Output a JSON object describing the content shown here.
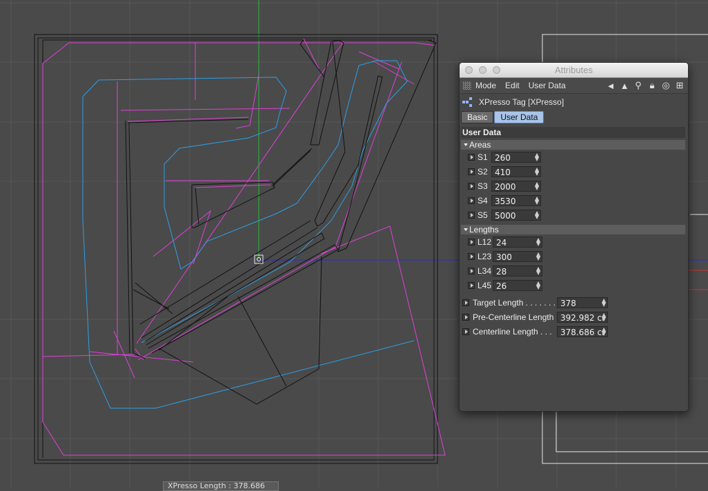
{
  "viewport": {
    "status_text": "XPresso Length : 378.686"
  },
  "window": {
    "title": "Attributes",
    "menu": [
      "Mode",
      "Edit",
      "User Data"
    ],
    "tool_icons": [
      "arrow-left-icon",
      "arrow-up-icon",
      "search-icon",
      "lock-icon",
      "target-icon",
      "add-icon"
    ],
    "object_name": "XPresso Tag [XPresso]",
    "tabs": [
      {
        "label": "Basic",
        "active": false
      },
      {
        "label": "User Data",
        "active": true
      }
    ],
    "section_title": "User Data",
    "groups": {
      "areas": {
        "title": "Areas",
        "params": [
          {
            "label": "S1",
            "value": "260"
          },
          {
            "label": "S2",
            "value": "410"
          },
          {
            "label": "S3",
            "value": "2000"
          },
          {
            "label": "S4",
            "value": "3530"
          },
          {
            "label": "S5",
            "value": "5000"
          }
        ]
      },
      "lengths": {
        "title": "Lengths",
        "params": [
          {
            "label": "L12",
            "value": "24"
          },
          {
            "label": "L23",
            "value": "300"
          },
          {
            "label": "L34",
            "value": "28"
          },
          {
            "label": "L45",
            "value": "26"
          }
        ]
      }
    },
    "loose_params": [
      {
        "label": "Target Length . . . . . . .",
        "value": "378"
      },
      {
        "label": "Pre-Centerline Length",
        "value": "392.982 cı"
      },
      {
        "label": "Centerline Length . . .",
        "value": "378.686 cı"
      }
    ]
  },
  "colors": {
    "background": "#4a4a4a",
    "grid": "#555555",
    "spline_magenta": "#e040d8",
    "spline_blue": "#2aa0e8",
    "geometry": "#111111",
    "axis_green": "#1fbf3a",
    "axis_blue": "#2a2ad8",
    "tab_active": "#a8c4e8"
  }
}
